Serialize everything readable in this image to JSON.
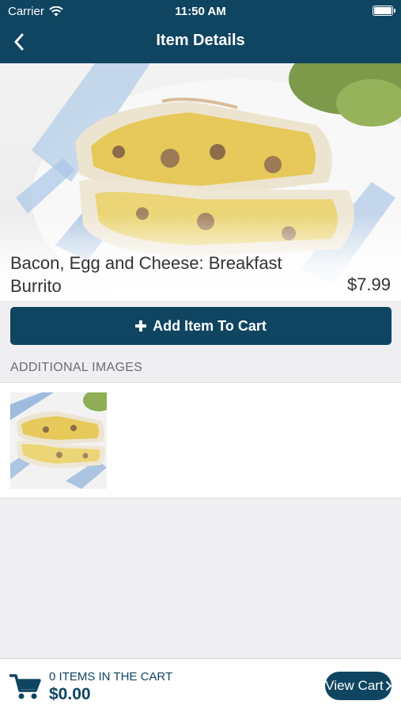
{
  "status_bar": {
    "carrier": "Carrier",
    "time": "11:50 AM"
  },
  "nav": {
    "title": "Item Details",
    "back_icon": "chevron-left-icon"
  },
  "item": {
    "name": "Bacon, Egg and Cheese: Breakfast Burrito",
    "price": "$7.99",
    "image": "breakfast burrito photo"
  },
  "actions": {
    "add_to_cart_label": "Add Item To Cart",
    "add_icon": "plus-icon"
  },
  "additional_images": {
    "header": "ADDITIONAL IMAGES"
  },
  "cart": {
    "count_label": "0 ITEMS IN THE CART",
    "total": "$0.00",
    "view_cart_label": "View Cart",
    "cart_icon": "shopping-cart-icon"
  },
  "colors": {
    "brand": "#0f4561",
    "background": "#efeff1"
  }
}
